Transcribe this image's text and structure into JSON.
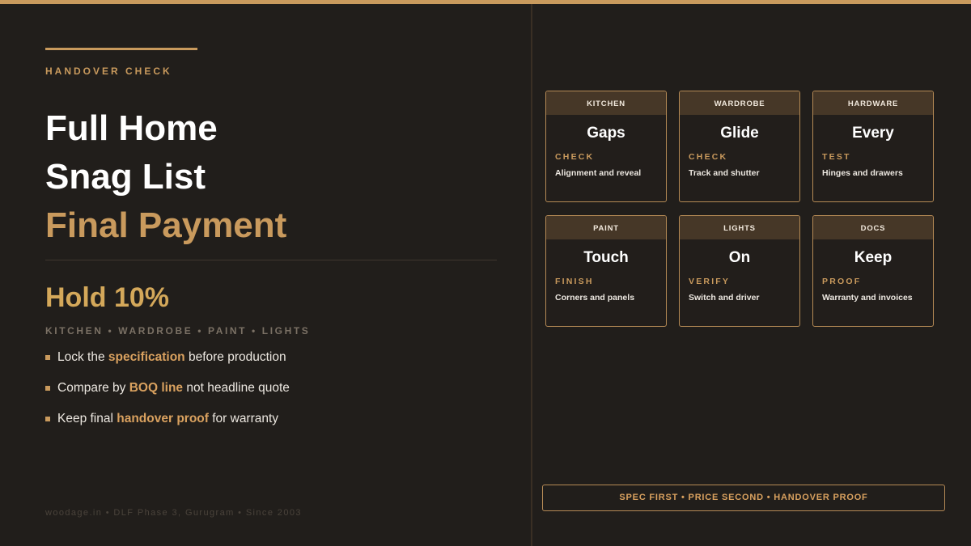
{
  "eyebrow": "HANDOVER CHECK",
  "title": {
    "line1": "Full Home",
    "line2": "Snag List",
    "line3": "Final Payment"
  },
  "hold": "Hold 10%",
  "categories_line": "KITCHEN • WARDROBE • PAINT • LIGHTS",
  "bullets": [
    {
      "before": "Lock the ",
      "highlight": "specification",
      "after": " before production"
    },
    {
      "before": "Compare by ",
      "highlight": "BOQ line",
      "after": " not headline quote"
    },
    {
      "before": "Keep final ",
      "highlight": "handover proof",
      "after": " for warranty"
    }
  ],
  "footer": "woodage.in • DLF Phase 3, Gurugram • Since 2003",
  "cards": [
    {
      "head": "KITCHEN",
      "value": "Gaps",
      "label": "CHECK",
      "desc": "Alignment and reveal"
    },
    {
      "head": "WARDROBE",
      "value": "Glide",
      "label": "CHECK",
      "desc": "Track and shutter"
    },
    {
      "head": "HARDWARE",
      "value": "Every",
      "label": "TEST",
      "desc": "Hinges and drawers"
    },
    {
      "head": "PAINT",
      "value": "Touch",
      "label": "FINISH",
      "desc": "Corners and panels"
    },
    {
      "head": "LIGHTS",
      "value": "On",
      "label": "VERIFY",
      "desc": "Switch and driver"
    },
    {
      "head": "DOCS",
      "value": "Keep",
      "label": "PROOF",
      "desc": "Warranty and invoices"
    }
  ],
  "tagline": "SPEC FIRST • PRICE SECOND • HANDOVER PROOF",
  "colors": {
    "background": "#211e1b",
    "accent": "#c99a5d",
    "hold": "#d4a85a",
    "card_head": "#463727"
  }
}
